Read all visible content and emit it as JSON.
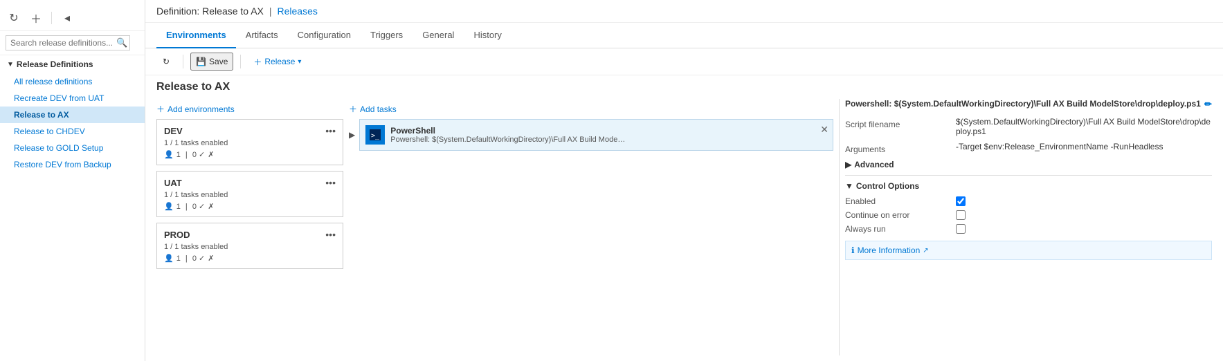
{
  "sidebar": {
    "section_label": "Release Definitions",
    "items": [
      {
        "id": "all",
        "label": "All release definitions",
        "active": false
      },
      {
        "id": "recreate",
        "label": "Recreate DEV from UAT",
        "active": false
      },
      {
        "id": "release-to-ax",
        "label": "Release to AX",
        "active": true
      },
      {
        "id": "release-to-chdev",
        "label": "Release to CHDEV",
        "active": false
      },
      {
        "id": "release-to-gold",
        "label": "Release to GOLD Setup",
        "active": false
      },
      {
        "id": "restore-dev",
        "label": "Restore DEV from Backup",
        "active": false
      }
    ],
    "search_placeholder": "Search release definitions..."
  },
  "breadcrumb": {
    "definition_prefix": "Definition: Release to AX",
    "separator": "|",
    "releases_link": "Releases"
  },
  "tabs": [
    {
      "id": "environments",
      "label": "Environments",
      "active": true
    },
    {
      "id": "artifacts",
      "label": "Artifacts",
      "active": false
    },
    {
      "id": "configuration",
      "label": "Configuration",
      "active": false
    },
    {
      "id": "triggers",
      "label": "Triggers",
      "active": false
    },
    {
      "id": "general",
      "label": "General",
      "active": false
    },
    {
      "id": "history",
      "label": "History",
      "active": false
    }
  ],
  "toolbar": {
    "refresh_title": "Refresh",
    "save_label": "Save",
    "release_label": "Release"
  },
  "page_title": "Release to AX",
  "environments": {
    "add_label": "Add environments",
    "items": [
      {
        "name": "DEV",
        "tasks_status": "1 / 1 tasks enabled",
        "people_count": "1",
        "check_count": "0 ✓x"
      },
      {
        "name": "UAT",
        "tasks_status": "1 / 1 tasks enabled",
        "people_count": "1",
        "check_count": "0 ✓x"
      },
      {
        "name": "PROD",
        "tasks_status": "1 / 1 tasks enabled",
        "people_count": "1",
        "check_count": "0 ✓x"
      }
    ]
  },
  "tasks": {
    "add_label": "Add tasks",
    "items": [
      {
        "name": "PowerShell",
        "description": "Powershell: $(System.DefaultWorkingDirectory)\\Full AX Build ModelStore\\drop\\depl..."
      }
    ]
  },
  "properties": {
    "title": "Powershell: $(System.DefaultWorkingDirectory)\\Full AX Build ModelStore\\drop\\deploy.ps1",
    "script_filename_label": "Script filename",
    "script_filename_value": "$(System.DefaultWorkingDirectory)\\Full AX Build ModelStore\\drop\\deploy.ps1",
    "arguments_label": "Arguments",
    "arguments_value": "-Target $env:Release_EnvironmentName -RunHeadless",
    "advanced_label": "Advanced",
    "control_options_label": "Control Options",
    "enabled_label": "Enabled",
    "continue_on_error_label": "Continue on error",
    "always_run_label": "Always run",
    "more_info_label": "More Information",
    "enabled_checked": true,
    "continue_on_error_checked": false,
    "always_run_checked": false
  }
}
